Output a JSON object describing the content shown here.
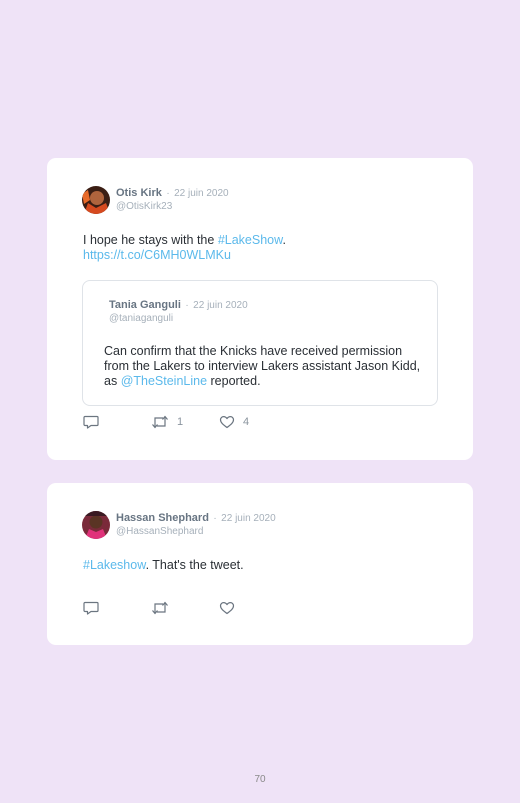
{
  "tweets": [
    {
      "author": "Otis Kirk",
      "date": "22 juin 2020",
      "handle": "@OtisKirk23",
      "text_prefix": "I hope he stays with the ",
      "hashtag": "#LakeShow",
      "text_suffix": ".",
      "url": "https://t.co/C6MH0WLMKu",
      "quote": {
        "author": "Tania Ganguli",
        "date": "22 juin 2020",
        "handle": "@taniaganguli",
        "text": "Can confirm that the Knicks have received permission from the Lakers to interview Lakers assistant Jason Kidd, as ",
        "mention": "@TheSteinLine",
        "text_suffix": " reported."
      },
      "retweets": "1",
      "likes": "4"
    },
    {
      "author": "Hassan Shephard",
      "date": "22 juin 2020",
      "handle": "@HassanShephard",
      "hashtag": "#Lakeshow",
      "text_suffix": ". That's the tweet."
    }
  ],
  "separator": "·",
  "page_number": "70",
  "colors": {
    "background": "#efe3f7",
    "link": "#5bb9eb",
    "name": "#687583"
  },
  "icons": [
    "reply-icon",
    "retweet-icon",
    "like-icon"
  ]
}
